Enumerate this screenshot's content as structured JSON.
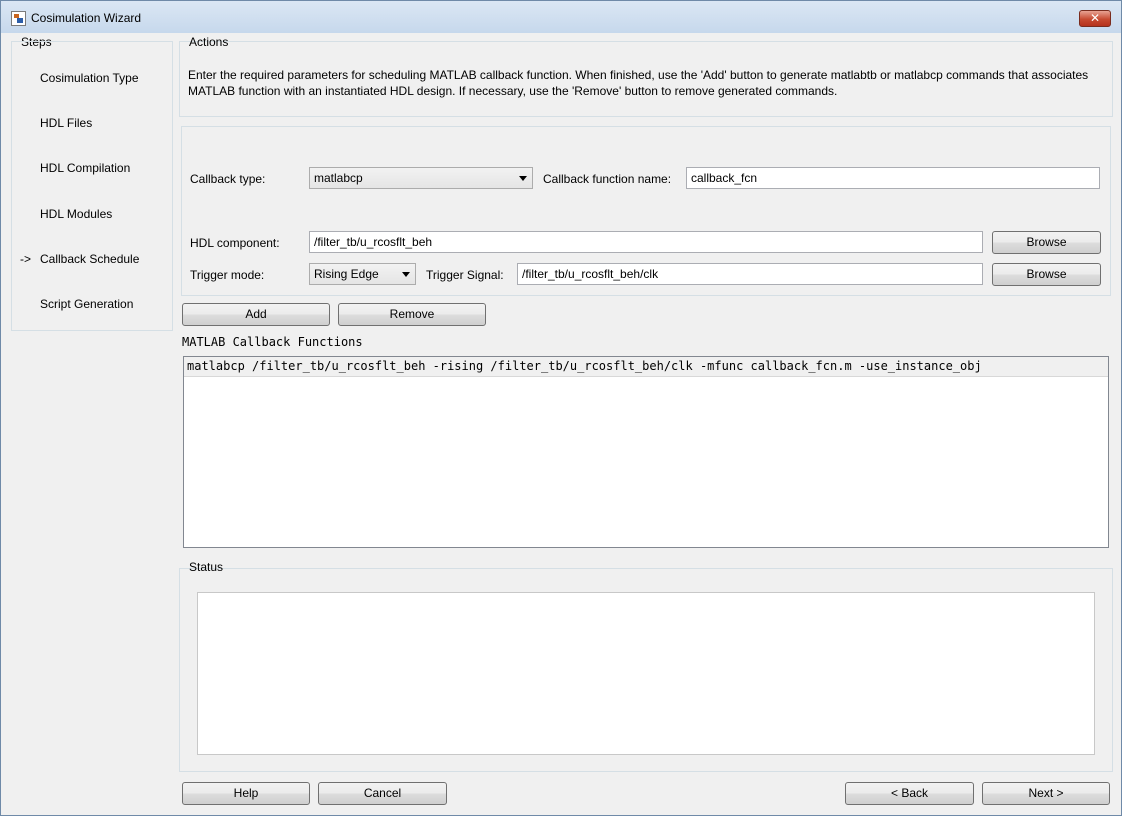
{
  "window": {
    "title": "Cosimulation Wizard",
    "close_label": "✕"
  },
  "steps": {
    "group_label": "Steps",
    "current_marker": "->",
    "items": [
      {
        "label": "Cosimulation Type"
      },
      {
        "label": "HDL Files"
      },
      {
        "label": "HDL Compilation"
      },
      {
        "label": "HDL Modules"
      },
      {
        "label": "Callback Schedule"
      },
      {
        "label": "Script Generation"
      }
    ]
  },
  "actions": {
    "group_label": "Actions",
    "description": "Enter the required parameters for scheduling MATLAB callback function. When finished, use the 'Add' button to generate matlabtb or matlabcp commands that associates MATLAB function with an instantiated HDL design. If necessary, use the 'Remove' button to remove generated commands."
  },
  "params": {
    "callback_type_label": "Callback type:",
    "callback_type_value": "matlabcp",
    "callback_name_label": "Callback function name:",
    "callback_name_value": "callback_fcn",
    "hdl_component_label": "HDL component:",
    "hdl_component_value": "/filter_tb/u_rcosflt_beh",
    "browse_label": "Browse",
    "trigger_mode_label": "Trigger mode:",
    "trigger_mode_value": "Rising Edge",
    "trigger_signal_label": "Trigger Signal:",
    "trigger_signal_value": "/filter_tb/u_rcosflt_beh/clk"
  },
  "list_actions": {
    "add_label": "Add",
    "remove_label": "Remove"
  },
  "callbacks": {
    "title": "MATLAB Callback Functions",
    "rows": [
      "matlabcp /filter_tb/u_rcosflt_beh -rising /filter_tb/u_rcosflt_beh/clk -mfunc callback_fcn.m -use_instance_obj"
    ]
  },
  "status": {
    "group_label": "Status",
    "text": ""
  },
  "footer": {
    "help_label": "Help",
    "cancel_label": "Cancel",
    "back_label": "< Back",
    "next_label": "Next >"
  }
}
